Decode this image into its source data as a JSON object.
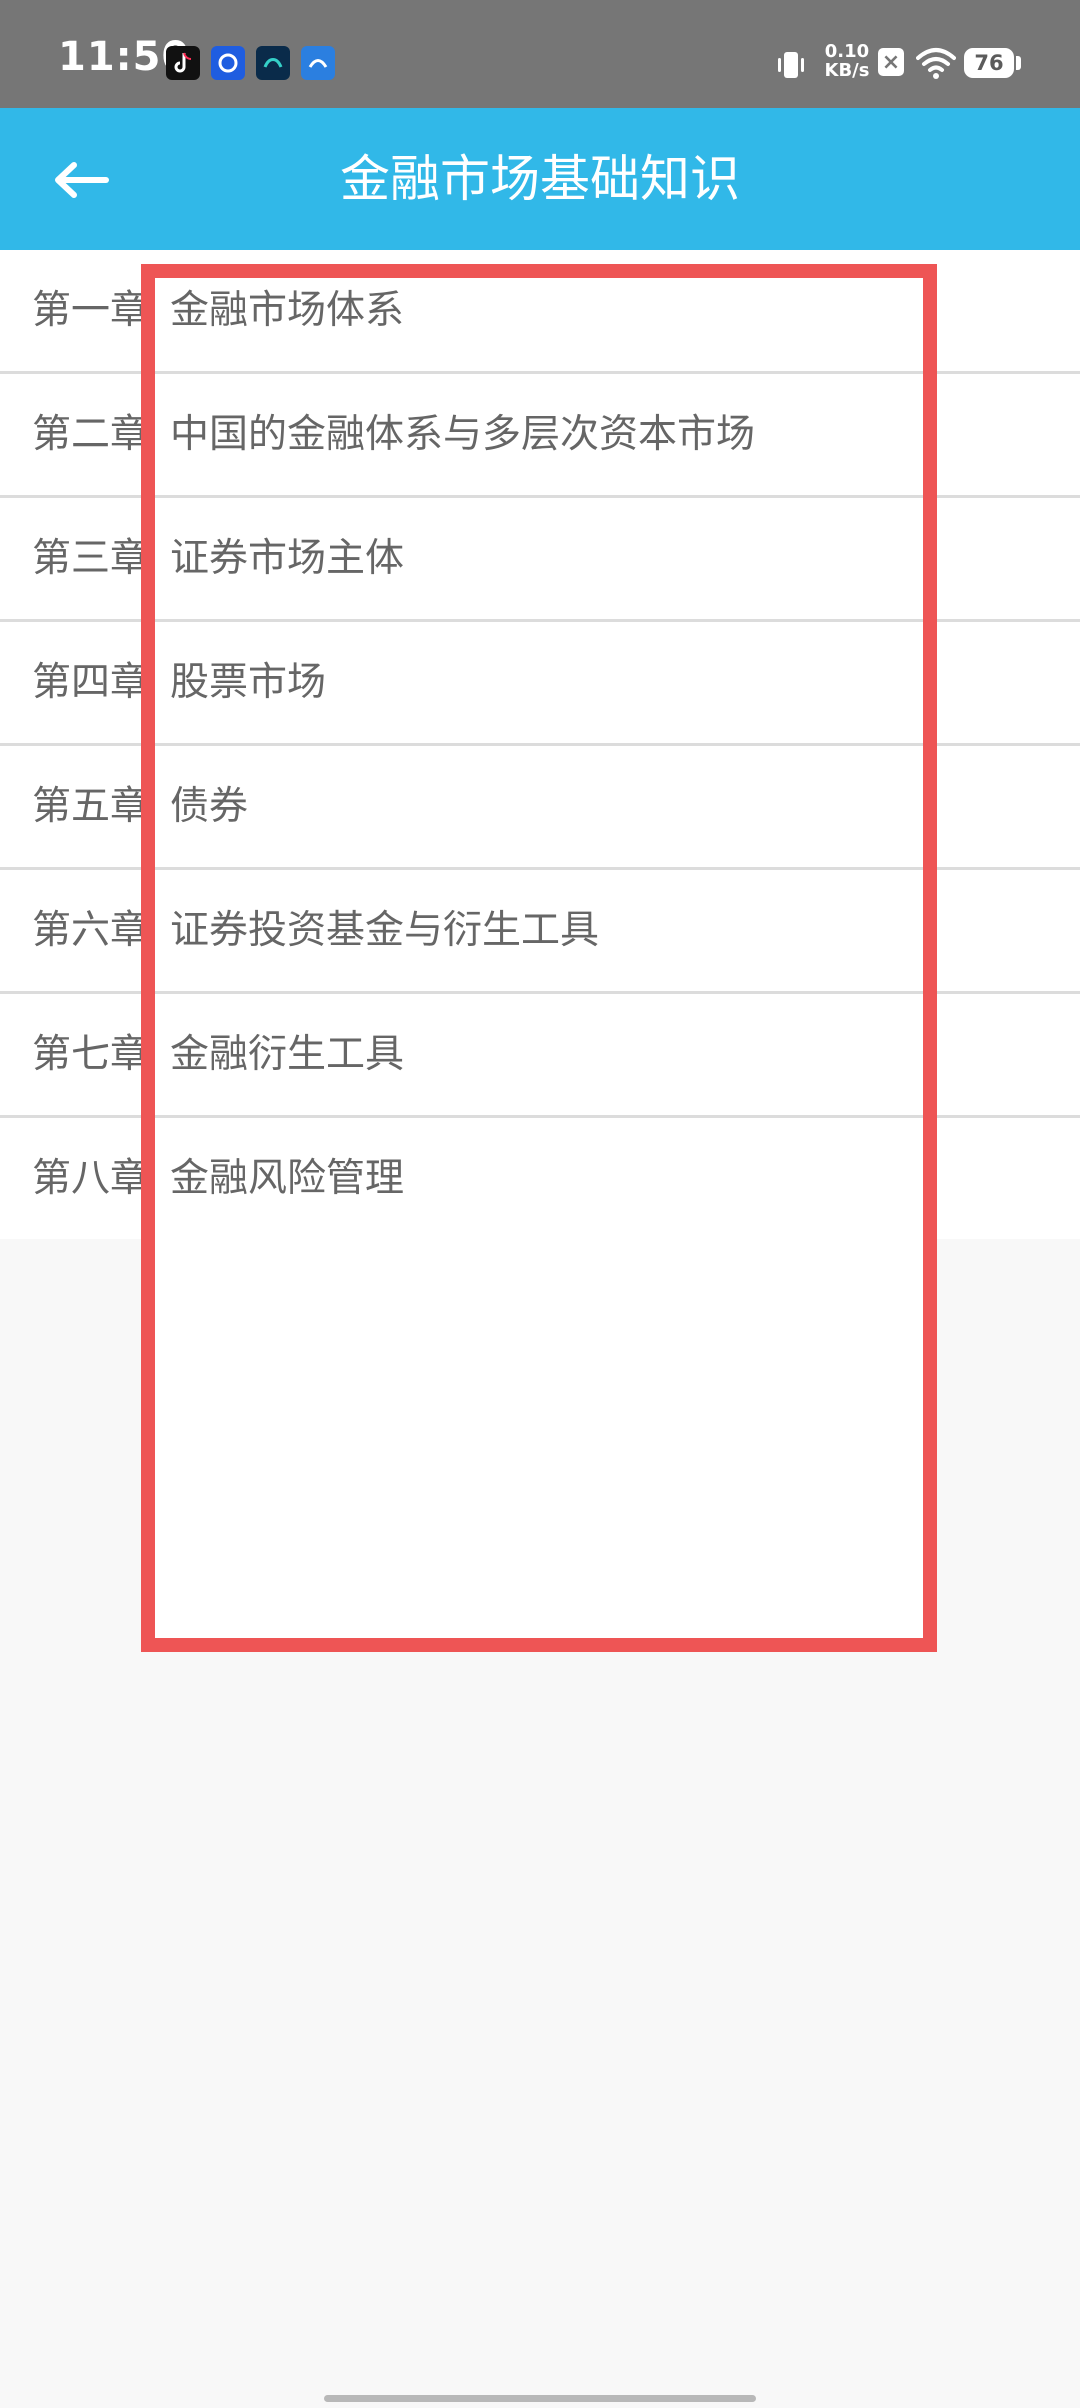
{
  "status_bar": {
    "time": "11:50",
    "app_icons": [
      "tiktok-icon",
      "app-icon",
      "app-icon",
      "app-icon"
    ],
    "net_speed_value": "0.10",
    "net_speed_unit": "KB/s",
    "battery_level": "76"
  },
  "toolbar": {
    "title": "金融市场基础知识",
    "back_icon": "arrow-left-icon"
  },
  "chapters": [
    {
      "number": "第一章",
      "title": "金融市场体系"
    },
    {
      "number": "第二章",
      "title": "中国的金融体系与多层次资本市场"
    },
    {
      "number": "第三章",
      "title": "证券市场主体"
    },
    {
      "number": "第四章",
      "title": "股票市场"
    },
    {
      "number": "第五章",
      "title": "债券"
    },
    {
      "number": "第六章",
      "title": "证券投资基金与衍生工具"
    },
    {
      "number": "第七章",
      "title": "金融衍生工具"
    },
    {
      "number": "第八章",
      "title": "金融风险管理"
    }
  ],
  "colors": {
    "status_bar": "#767676",
    "toolbar": "#31b8e8",
    "highlight_border": "#ee5555",
    "list_text": "#666666",
    "divider": "#dcdcdc",
    "page_background": "#f8f8f8"
  }
}
